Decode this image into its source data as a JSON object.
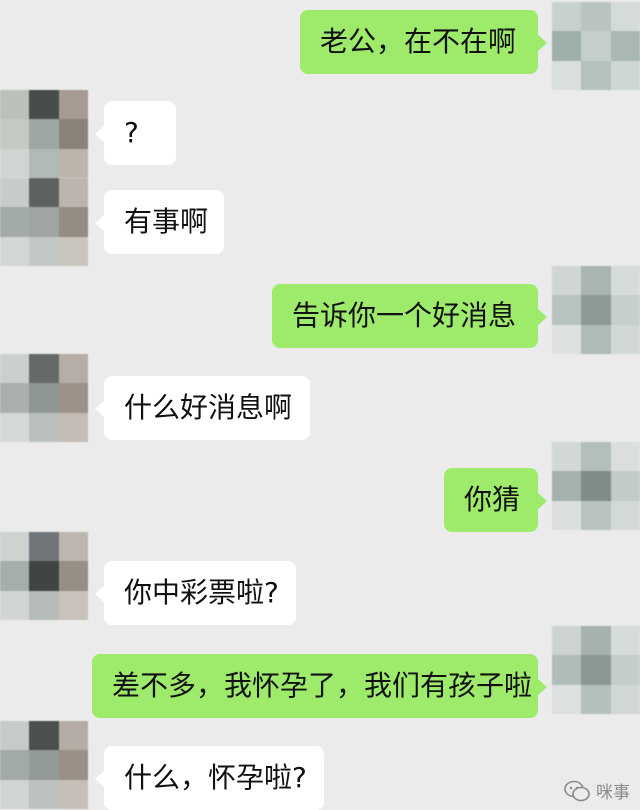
{
  "messages": [
    {
      "side": "out",
      "text": "老公，在不在啊"
    },
    {
      "side": "in",
      "text": "?"
    },
    {
      "side": "in",
      "text": "有事啊"
    },
    {
      "side": "out",
      "text": "告诉你一个好消息"
    },
    {
      "side": "in",
      "text": "什么好消息啊"
    },
    {
      "side": "out",
      "text": "你猜"
    },
    {
      "side": "in",
      "text": "你中彩票啦?"
    },
    {
      "side": "out",
      "text": "差不多，我怀孕了，我们有孩子啦"
    },
    {
      "side": "in",
      "text": "什么，怀孕啦?"
    }
  ],
  "watermark": {
    "text": "咪事",
    "icon": "wechat-official-account-icon"
  },
  "colors": {
    "background": "#ebebeb",
    "bubble_in": "#ffffff",
    "bubble_out": "#9eea6a"
  }
}
